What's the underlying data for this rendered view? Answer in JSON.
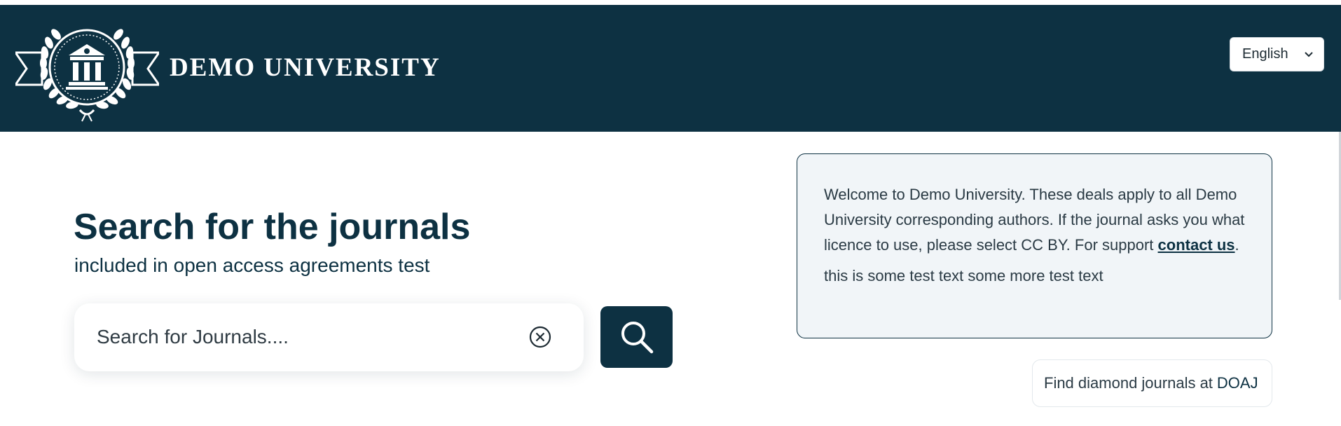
{
  "header": {
    "brand": "DEMO UNIVERSITY",
    "language": {
      "selected": "English",
      "options": [
        "English"
      ]
    }
  },
  "hero": {
    "title": "Search for the journals",
    "subtitle": "included in open access agreements test"
  },
  "search": {
    "placeholder": "Search for Journals....",
    "value": ""
  },
  "info": {
    "text_before_link": "Welcome to Demo University. These deals apply to all Demo University corresponding authors. If the journal asks you what licence to use, please select CC BY. For support ",
    "link_text": "contact us",
    "text_after_link": ".",
    "extra_text": "this is some test text some more test text"
  },
  "doaj": {
    "text": "Find diamond journals at",
    "link_text": "DOAJ"
  },
  "colors": {
    "primary": "#0d3142",
    "panel_bg": "#f1f5f8",
    "white": "#ffffff"
  },
  "icons": {
    "logo": "university-crest-logo",
    "language_chevron": "chevron-down-icon",
    "clear": "clear-circle-x-icon",
    "search": "search-icon"
  }
}
